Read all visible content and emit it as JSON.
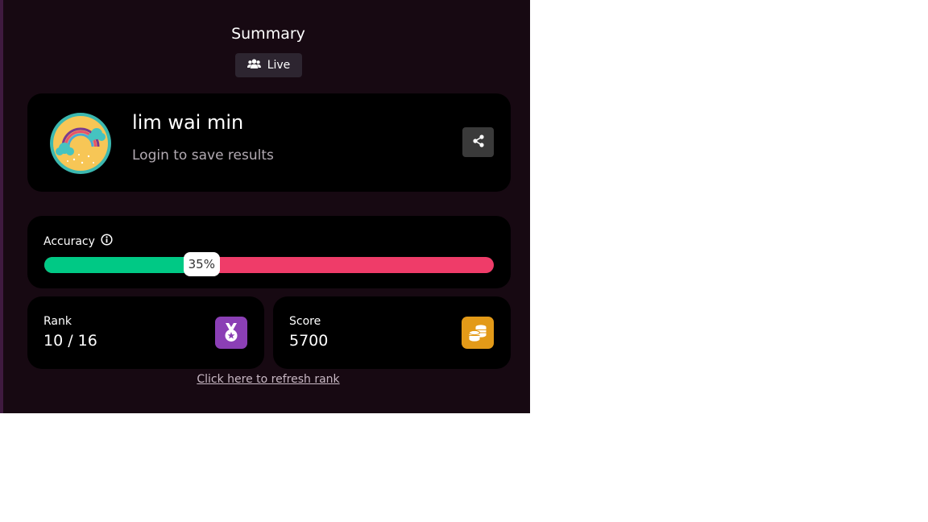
{
  "summary": {
    "title": "Summary",
    "mode_label": "Live",
    "mode_icon": "users-icon"
  },
  "player": {
    "name": "lim wai min",
    "login_prompt": "Login to save results",
    "avatar_icon": "rainbow-avatar-icon",
    "share_icon": "share-icon"
  },
  "accuracy": {
    "label": "Accuracy",
    "info_icon": "info-icon",
    "percent_value": 35,
    "percent_label": "35%",
    "correct_color": "#00c985",
    "incorrect_color": "#ef3c69"
  },
  "rank": {
    "label": "Rank",
    "value": "10 / 16",
    "icon": "medal-icon",
    "color": "#8b3fb5"
  },
  "score": {
    "label": "Score",
    "value": "5700",
    "icon": "coins-icon",
    "color": "#e39a18"
  },
  "refresh_link": "Click here to refresh rank"
}
